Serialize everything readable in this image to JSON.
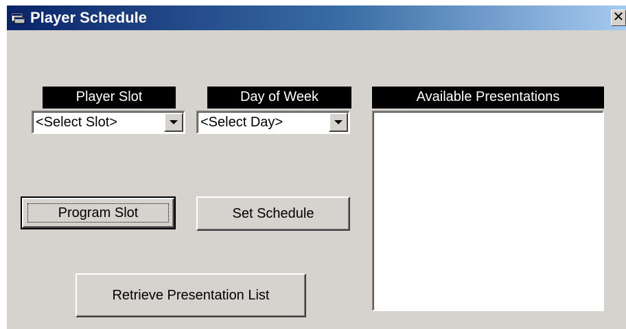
{
  "window": {
    "title": "Player Schedule",
    "icon": "app-window-icon",
    "close_label": "✕"
  },
  "player_slot": {
    "label": "Player Slot",
    "selected": "<Select Slot>"
  },
  "day_of_week": {
    "label": "Day of Week",
    "selected": "<Select Day>"
  },
  "presentations": {
    "label": "Available Presentations",
    "items": []
  },
  "buttons": {
    "program_slot": "Program Slot",
    "set_schedule": "Set Schedule",
    "retrieve_list": "Retrieve Presentation List"
  },
  "colors": {
    "titlebar_start": "#0a246a",
    "titlebar_end": "#a6caf0",
    "face": "#d6d3ce"
  }
}
